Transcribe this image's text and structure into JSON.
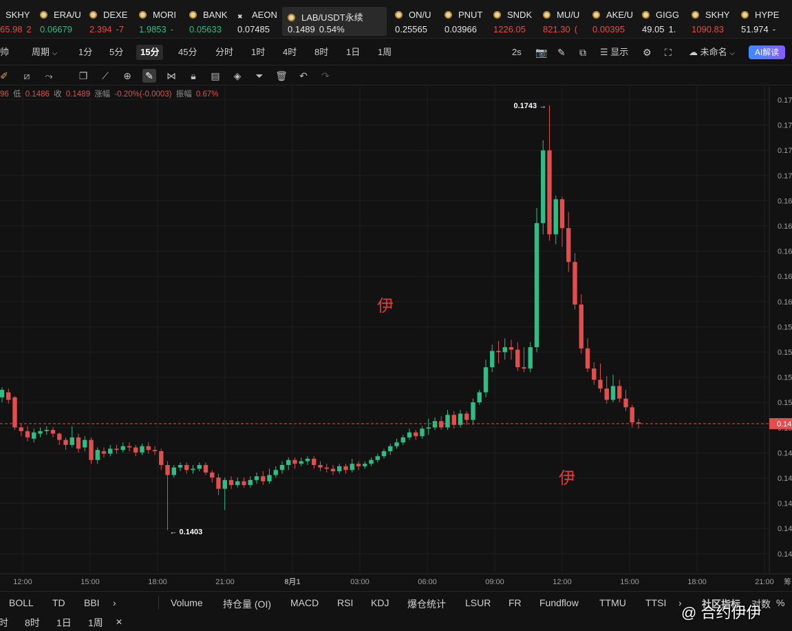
{
  "tickers": [
    {
      "symbol": "SKHY",
      "value": "65.98",
      "change": "2",
      "color": "dn",
      "change_color": "dn"
    },
    {
      "symbol": "ERA/U",
      "value": "0.06679",
      "change": "",
      "color": "up"
    },
    {
      "symbol": "DEXE",
      "value": "2.394",
      "change": "-7",
      "color": "dn",
      "change_color": "dn"
    },
    {
      "symbol": "MORI",
      "value": "1.9853",
      "change": "-",
      "color": "up",
      "change_color": "up"
    },
    {
      "symbol": "BANK",
      "value": "0.05633",
      "change": "",
      "color": "up"
    },
    {
      "symbol": "AEON",
      "value": "0.07485",
      "change": "",
      "color": "nu"
    },
    {
      "symbol": "LAB/USDT永续",
      "value": "0.1489",
      "change": "0.54%",
      "color": "nu",
      "change_color": "nu"
    },
    {
      "symbol": "ON/U",
      "value": "0.25565",
      "change": "",
      "color": "nu"
    },
    {
      "symbol": "PNUT",
      "value": "0.03966",
      "change": "",
      "color": "nu"
    },
    {
      "symbol": "SNDK",
      "value": "1226.05",
      "change": "",
      "color": "dn"
    },
    {
      "symbol": "MU/U",
      "value": "821.30",
      "change": "(",
      "color": "dn",
      "change_color": "dn"
    },
    {
      "symbol": "AKE/U",
      "value": "0.00395",
      "change": "",
      "color": "dn"
    },
    {
      "symbol": "GIGG",
      "value": "49.05",
      "change": "1.",
      "color": "nu",
      "change_color": "nu"
    },
    {
      "symbol": "SKHY",
      "value": "1090.83",
      "change": "",
      "color": "dn"
    },
    {
      "symbol": "HYPE",
      "value": "51.974",
      "change": "-",
      "color": "nu",
      "change_color": "nu"
    }
  ],
  "periodbar": {
    "left_label": "帅",
    "period_label": "周期",
    "intervals": [
      "1分",
      "5分",
      "15分",
      "45分",
      "分时",
      "1时",
      "4时",
      "8时",
      "1日",
      "1周"
    ],
    "selected_interval": "15分",
    "refresh": "2s",
    "display_label": "显示",
    "layout_name": "未命名",
    "ai_label": "AI解读"
  },
  "stats": {
    "open_tail": "96",
    "low_label": "低",
    "low_value": "0.1486",
    "close_label": "收",
    "close_value": "0.1489",
    "change_label": "涨幅",
    "change_value": "-0.20%(-0.0003)",
    "amp_label": "振幅",
    "amp_value": "0.67%"
  },
  "chart_data": {
    "type": "candlestick",
    "interval": "15m",
    "x_ticks": [
      "12:00",
      "15:00",
      "18:00",
      "21:00",
      "8月1",
      "03:00",
      "06:00",
      "09:00",
      "12:00",
      "15:00",
      "18:00",
      "21:00"
    ],
    "y_ticks": [
      "0.17",
      "0.17",
      "0.17",
      "0.17",
      "0.16",
      "0.16",
      "0.16",
      "0.16",
      "0.16",
      "0.15",
      "0.15",
      "0.15",
      "0.15",
      "0.15",
      "0.14",
      "0.14",
      "0.14",
      "0.14",
      "0.14"
    ],
    "ylim": [
      0.1395,
      0.1755
    ],
    "high_marker": "0.1743",
    "low_marker": "0.1403",
    "current_price_label": "0.14",
    "current_price": 0.1489,
    "bullish_color": "#2fbd85",
    "bearish_color": "#e24d4d",
    "ohlc": [
      [
        0.151,
        0.1516,
        0.1506,
        0.1518
      ],
      [
        0.1514,
        0.1508,
        0.1505,
        0.1517
      ],
      [
        0.151,
        0.1486,
        0.1484,
        0.1511
      ],
      [
        0.1486,
        0.1483,
        0.1479,
        0.1489
      ],
      [
        0.1483,
        0.1478,
        0.1475,
        0.1487
      ],
      [
        0.1477,
        0.1482,
        0.1474,
        0.1485
      ],
      [
        0.1481,
        0.1483,
        0.1478,
        0.1486
      ],
      [
        0.1483,
        0.1484,
        0.148,
        0.1487
      ],
      [
        0.1484,
        0.1481,
        0.1478,
        0.1486
      ],
      [
        0.1481,
        0.1476,
        0.1472,
        0.1482
      ],
      [
        0.1476,
        0.1472,
        0.1468,
        0.1478
      ],
      [
        0.1472,
        0.1478,
        0.147,
        0.1487
      ],
      [
        0.1478,
        0.1469,
        0.1466,
        0.1481
      ],
      [
        0.147,
        0.1476,
        0.1467,
        0.1479
      ],
      [
        0.1476,
        0.146,
        0.1457,
        0.1478
      ],
      [
        0.146,
        0.1468,
        0.1457,
        0.147
      ],
      [
        0.1467,
        0.1465,
        0.1462,
        0.147
      ],
      [
        0.1465,
        0.1469,
        0.1463,
        0.1472
      ],
      [
        0.1469,
        0.1468,
        0.1465,
        0.1472
      ],
      [
        0.1468,
        0.1471,
        0.1466,
        0.1474
      ],
      [
        0.1471,
        0.147,
        0.1467,
        0.1474
      ],
      [
        0.147,
        0.1466,
        0.1463,
        0.1472
      ],
      [
        0.1466,
        0.1471,
        0.1464,
        0.1473
      ],
      [
        0.1471,
        0.1468,
        0.1465,
        0.1474
      ],
      [
        0.1468,
        0.1467,
        0.1464,
        0.1471
      ],
      [
        0.1467,
        0.1456,
        0.1452,
        0.1469
      ],
      [
        0.1456,
        0.1448,
        0.1404,
        0.1459
      ],
      [
        0.1448,
        0.1454,
        0.1446,
        0.1456
      ],
      [
        0.1454,
        0.1456,
        0.1451,
        0.1458
      ],
      [
        0.1456,
        0.1452,
        0.1449,
        0.1458
      ],
      [
        0.1452,
        0.1453,
        0.1449,
        0.1456
      ],
      [
        0.1453,
        0.1456,
        0.1451,
        0.1458
      ],
      [
        0.1456,
        0.145,
        0.1448,
        0.1458
      ],
      [
        0.145,
        0.1446,
        0.1442,
        0.1452
      ],
      [
        0.1446,
        0.1437,
        0.1432,
        0.1449
      ],
      [
        0.1437,
        0.1444,
        0.142,
        0.1446
      ],
      [
        0.1444,
        0.144,
        0.1437,
        0.1447
      ],
      [
        0.144,
        0.1443,
        0.1438,
        0.1446
      ],
      [
        0.1443,
        0.144,
        0.1438,
        0.1446
      ],
      [
        0.144,
        0.1444,
        0.1438,
        0.1447
      ],
      [
        0.1444,
        0.1447,
        0.1441,
        0.145
      ],
      [
        0.1447,
        0.1443,
        0.144,
        0.1451
      ],
      [
        0.1443,
        0.1448,
        0.1441,
        0.1453
      ],
      [
        0.1448,
        0.1452,
        0.1446,
        0.1455
      ],
      [
        0.1452,
        0.1456,
        0.1449,
        0.1459
      ],
      [
        0.1456,
        0.146,
        0.1452,
        0.1462
      ],
      [
        0.146,
        0.1457,
        0.1453,
        0.1462
      ],
      [
        0.1457,
        0.1459,
        0.1455,
        0.1462
      ],
      [
        0.1459,
        0.1461,
        0.1456,
        0.1463
      ],
      [
        0.1461,
        0.1456,
        0.1453,
        0.1463
      ],
      [
        0.1456,
        0.1454,
        0.1451,
        0.1459
      ],
      [
        0.1454,
        0.1453,
        0.145,
        0.1457
      ],
      [
        0.1453,
        0.1451,
        0.1448,
        0.1456
      ],
      [
        0.1451,
        0.1455,
        0.1449,
        0.1457
      ],
      [
        0.1455,
        0.1452,
        0.1449,
        0.1457
      ],
      [
        0.1452,
        0.1457,
        0.145,
        0.1461
      ],
      [
        0.1457,
        0.1455,
        0.1452,
        0.1459
      ],
      [
        0.1455,
        0.1457,
        0.1453,
        0.1459
      ],
      [
        0.1457,
        0.146,
        0.1455,
        0.1462
      ],
      [
        0.146,
        0.1463,
        0.1458,
        0.1465
      ],
      [
        0.1463,
        0.1467,
        0.1461,
        0.1469
      ],
      [
        0.1467,
        0.1471,
        0.1464,
        0.1473
      ],
      [
        0.1471,
        0.1474,
        0.1469,
        0.1477
      ],
      [
        0.1474,
        0.1478,
        0.1472,
        0.148
      ],
      [
        0.1478,
        0.1482,
        0.1476,
        0.1485
      ],
      [
        0.1482,
        0.1479,
        0.1476,
        0.1484
      ],
      [
        0.1479,
        0.1485,
        0.1477,
        0.1487
      ],
      [
        0.1485,
        0.1486,
        0.148,
        0.1493
      ],
      [
        0.1486,
        0.1491,
        0.1484,
        0.1494
      ],
      [
        0.1491,
        0.1486,
        0.1484,
        0.1495
      ],
      [
        0.1486,
        0.1496,
        0.1484,
        0.15
      ],
      [
        0.1496,
        0.1488,
        0.1485,
        0.1499
      ],
      [
        0.1488,
        0.1497,
        0.1486,
        0.15
      ],
      [
        0.1497,
        0.1492,
        0.1488,
        0.1499
      ],
      [
        0.1492,
        0.1506,
        0.1488,
        0.1509
      ],
      [
        0.1506,
        0.1514,
        0.1504,
        0.1516
      ],
      [
        0.1514,
        0.1534,
        0.151,
        0.154
      ],
      [
        0.1534,
        0.1547,
        0.153,
        0.1552
      ],
      [
        0.1547,
        0.1546,
        0.1537,
        0.1555
      ],
      [
        0.1546,
        0.155,
        0.154,
        0.1557
      ],
      [
        0.155,
        0.1548,
        0.154,
        0.1556
      ],
      [
        0.1548,
        0.1534,
        0.1531,
        0.1554
      ],
      [
        0.1534,
        0.1533,
        0.153,
        0.155
      ],
      [
        0.1533,
        0.155,
        0.153,
        0.1554
      ],
      [
        0.155,
        0.1649,
        0.1546,
        0.1661
      ],
      [
        0.1649,
        0.1707,
        0.164,
        0.1715
      ],
      [
        0.1707,
        0.164,
        0.1635,
        0.1743
      ],
      [
        0.164,
        0.1668,
        0.1632,
        0.1671
      ],
      [
        0.1668,
        0.1645,
        0.163,
        0.167
      ],
      [
        0.1645,
        0.1618,
        0.161,
        0.1658
      ],
      [
        0.1618,
        0.1584,
        0.158,
        0.1625
      ],
      [
        0.1584,
        0.1549,
        0.1545,
        0.1592
      ],
      [
        0.1549,
        0.1533,
        0.153,
        0.1557
      ],
      [
        0.1533,
        0.1524,
        0.152,
        0.1538
      ],
      [
        0.1524,
        0.1517,
        0.1514,
        0.1537
      ],
      [
        0.1517,
        0.1508,
        0.1505,
        0.1527
      ],
      [
        0.1508,
        0.1519,
        0.1506,
        0.1528
      ],
      [
        0.1519,
        0.1509,
        0.1506,
        0.1524
      ],
      [
        0.1509,
        0.1502,
        0.1499,
        0.1516
      ],
      [
        0.1502,
        0.149,
        0.1486,
        0.1504
      ],
      [
        0.149,
        0.1489,
        0.1485,
        0.1493
      ]
    ]
  },
  "annotations": {
    "mark_a": "伊",
    "mark_b": "伊"
  },
  "indicators": [
    "BOLL",
    "TD",
    "BBI",
    "Volume",
    "持仓量 (OI)",
    "MACD",
    "RSI",
    "KDJ",
    "爆仓统计",
    "LSUR",
    "FR",
    "Fundflow",
    "TTMU",
    "TTSI"
  ],
  "indicator_right": {
    "community": "社区指标",
    "scale": "对数",
    "percent": "%"
  },
  "bottom_intervals": [
    "时",
    "8时",
    "1日",
    "1周"
  ],
  "watermark": "@ 合约伊伊",
  "right_axis_edge": "筹"
}
